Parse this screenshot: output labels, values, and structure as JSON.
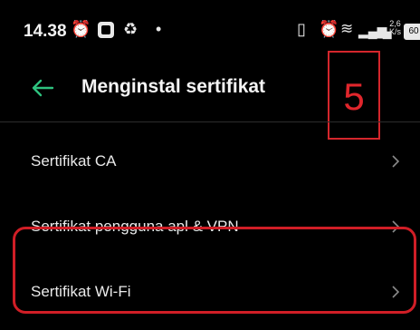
{
  "status_bar": {
    "time": "14.38",
    "speed_value": "2,6",
    "speed_unit": "K/s",
    "battery": "60"
  },
  "app_bar": {
    "title": "Menginstal sertifikat",
    "annotation": "5"
  },
  "items": [
    {
      "label": "Sertifikat CA"
    },
    {
      "label": "Sertifikat pengguna apl & VPN"
    },
    {
      "label": "Sertifikat Wi-Fi"
    }
  ],
  "colors": {
    "accent": "#2ec27e",
    "annotation_red": "#d4262c",
    "background": "#000000"
  },
  "icons": {
    "back": "arrow-left-icon",
    "chevron": "chevron-right-icon"
  }
}
